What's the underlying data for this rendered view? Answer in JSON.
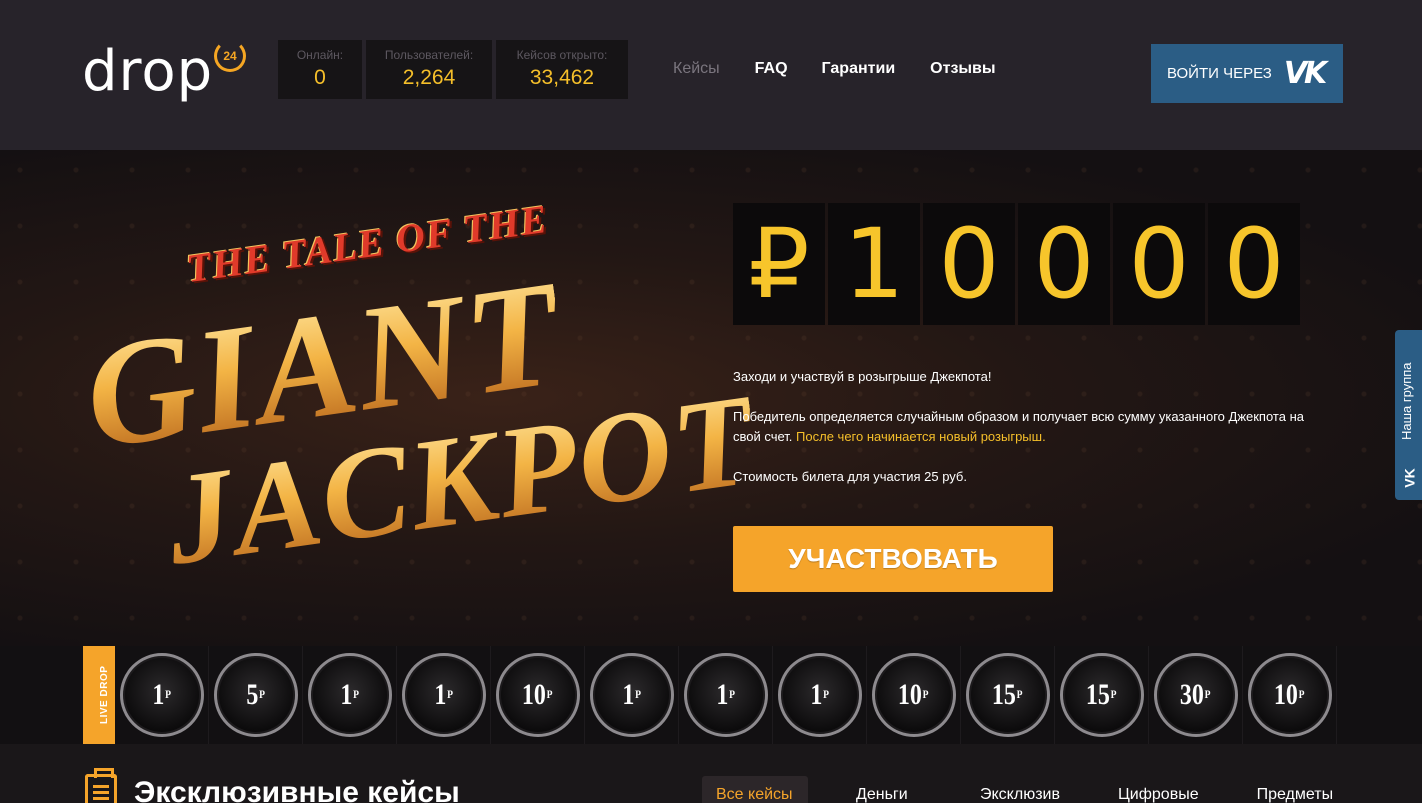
{
  "header": {
    "logo_text": "drop",
    "logo_badge": "24",
    "stats": [
      {
        "label": "Онлайн:",
        "value": "0"
      },
      {
        "label": "Пользователей:",
        "value": "2,264"
      },
      {
        "label": "Кейсов открыто:",
        "value": "33,462"
      }
    ],
    "nav": [
      "Кейсы",
      "FAQ",
      "Гарантии",
      "Отзывы"
    ],
    "login_label": "ВОЙТИ ЧЕРЕЗ",
    "login_icon": "vk-icon"
  },
  "hero": {
    "art_line1": "THE TALE OF THE",
    "art_line2": "GIANT",
    "art_line3": "JACKPOT",
    "counter_digits": [
      "₽",
      "1",
      "0",
      "0",
      "0",
      "0"
    ],
    "text1": "Заходи и участвуй в розыгрыше Джекпота!",
    "text2": "Победитель определяется случайным образом и получает всю сумму указанного Джекпота на свой счет.",
    "text2_highlight": "После чего начинается новый розыгрыш.",
    "text3": "Стоимость билета для участия 25 руб.",
    "button": "УЧАСТВОВАТЬ"
  },
  "vk_side": {
    "label": "Наша группа"
  },
  "live_drop": {
    "tag": "LIVE DROP",
    "currency": "Р",
    "items": [
      "1",
      "5",
      "1",
      "1",
      "10",
      "1",
      "1",
      "1",
      "10",
      "15",
      "15",
      "30",
      "10"
    ]
  },
  "exclusive": {
    "title": "Эксклюзивные кейсы",
    "filters": [
      "Все кейсы",
      "Деньги",
      "Эксклюзив",
      "Цифровые",
      "Предметы"
    ]
  },
  "colors": {
    "accent": "#f5a42a",
    "gold_text": "#f5bf2a",
    "vk_blue": "#2b5d85"
  }
}
